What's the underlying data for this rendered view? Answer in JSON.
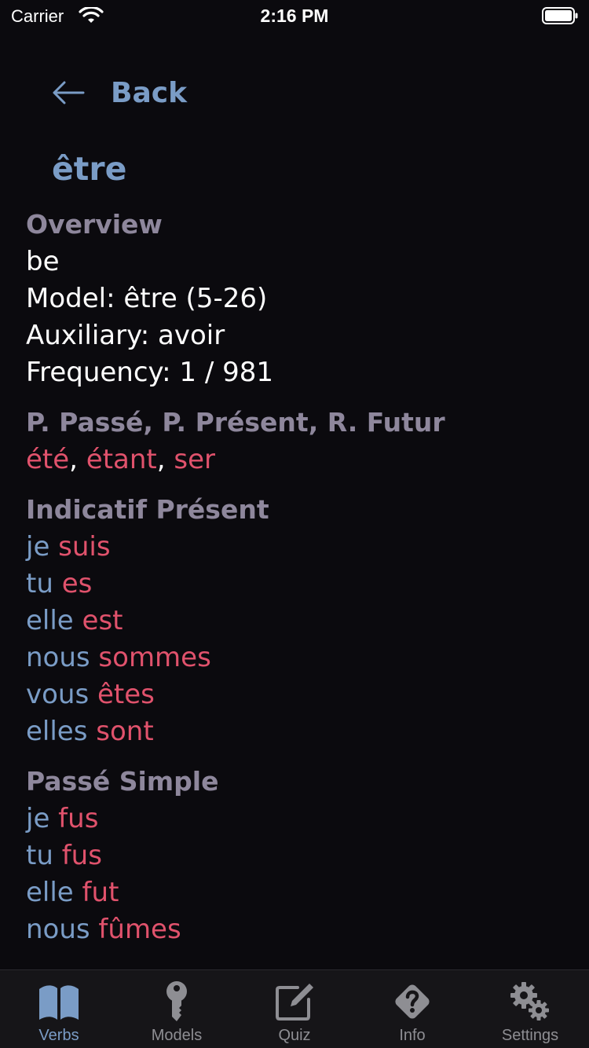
{
  "status_bar": {
    "carrier": "Carrier",
    "time": "2:16 PM"
  },
  "nav": {
    "back_label": "Back"
  },
  "verb": {
    "infinitive": "être"
  },
  "overview": {
    "title": "Overview",
    "meaning": "be",
    "model": "Model: être (5-26)",
    "auxiliary": "Auxiliary: avoir",
    "frequency": "Frequency: 1 / 981"
  },
  "participles": {
    "title": "P. Passé, P. Présent, R. Futur",
    "passe": "été",
    "present": "étant",
    "radical_futur": "ser",
    "separator": ", "
  },
  "indicatif_present": {
    "title": "Indicatif Présent",
    "rows": [
      {
        "pronoun": "je ",
        "form": "suis"
      },
      {
        "pronoun": "tu ",
        "form": "es"
      },
      {
        "pronoun": "elle ",
        "form": "est"
      },
      {
        "pronoun": "nous ",
        "form": "sommes"
      },
      {
        "pronoun": "vous ",
        "form": "êtes"
      },
      {
        "pronoun": "elles ",
        "form": "sont"
      }
    ]
  },
  "passe_simple": {
    "title": "Passé Simple",
    "rows": [
      {
        "pronoun": "je ",
        "form": "fus"
      },
      {
        "pronoun": "tu ",
        "form": "fus"
      },
      {
        "pronoun": "elle ",
        "form": "fut"
      },
      {
        "pronoun": "nous ",
        "form": "fûmes"
      }
    ]
  },
  "tab_bar": {
    "tabs": [
      {
        "label": "Verbs",
        "icon": "book-icon",
        "active": true
      },
      {
        "label": "Models",
        "icon": "key-icon",
        "active": false
      },
      {
        "label": "Quiz",
        "icon": "edit-icon",
        "active": false
      },
      {
        "label": "Info",
        "icon": "question-icon",
        "active": false
      },
      {
        "label": "Settings",
        "icon": "gears-icon",
        "active": false
      }
    ]
  },
  "colors": {
    "background": "#0b0a0e",
    "accent_blue": "#7a9cc6",
    "accent_pink": "#e0526c",
    "section_gray": "#8e879c",
    "tab_inactive": "#8e8e93"
  }
}
